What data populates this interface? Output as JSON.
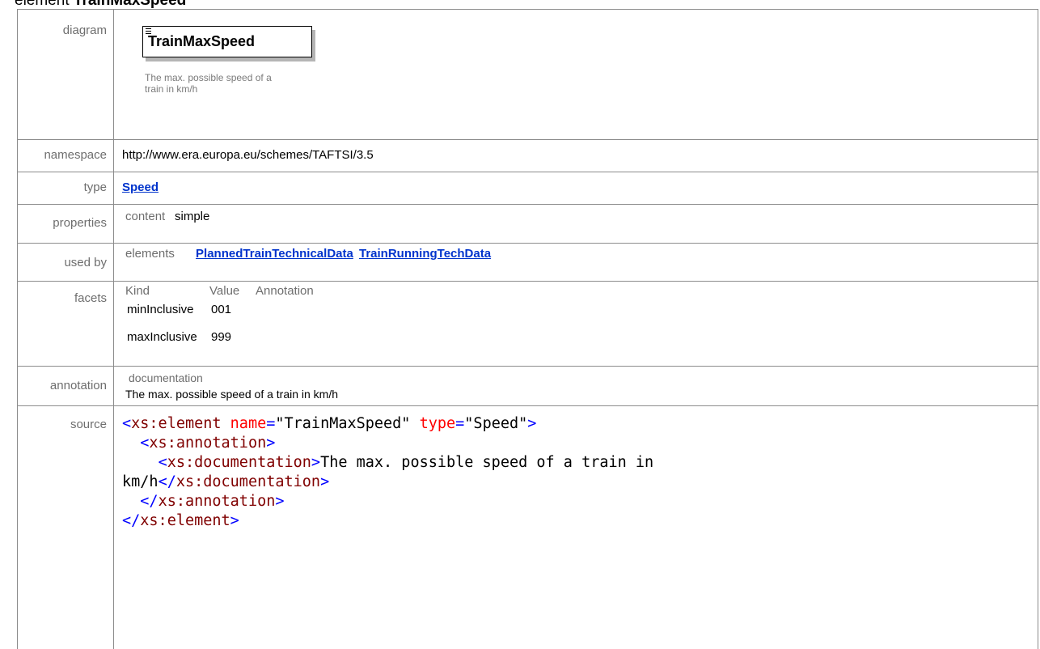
{
  "heading": {
    "prefix": "element",
    "name": "TrainMaxSpeed"
  },
  "rows": {
    "diagram": {
      "label": "diagram",
      "box_name": "TrainMaxSpeed",
      "doc_line1": "The max. possible speed of a",
      "doc_line2": "train in km/h"
    },
    "namespace": {
      "label": "namespace",
      "value": "http://www.era.europa.eu/schemes/TAFTSI/3.5"
    },
    "type": {
      "label": "type",
      "value": "Speed"
    },
    "properties": {
      "label": "properties",
      "key": "content",
      "value": "simple"
    },
    "used_by": {
      "label": "used by",
      "key": "elements",
      "links": [
        "PlannedTrainTechnicalData",
        "TrainRunningTechData"
      ]
    },
    "facets": {
      "label": "facets",
      "headers": [
        "Kind",
        "Value",
        "Annotation"
      ],
      "rows": [
        {
          "kind": "minInclusive",
          "value": "001"
        },
        {
          "kind": "maxInclusive",
          "value": "999"
        }
      ]
    },
    "annotation": {
      "label": "annotation",
      "key": "documentation",
      "value": "The max. possible speed of a train in km/h"
    },
    "source": {
      "label": "source",
      "lt": "<",
      "gt": ">",
      "close_open": "</",
      "el_tag": "xs:element",
      "attr_name": "name",
      "eq": "=",
      "name_val": "\"TrainMaxSpeed\"",
      "attr_type": "type",
      "type_val": "\"Speed\"",
      "ann_tag": "xs:annotation",
      "doc_tag": "xs:documentation",
      "doc_text_1": "The max. possible speed of a train in",
      "doc_text_2": "km/h"
    }
  },
  "colors": {
    "link": "#0033cc",
    "tag": "#0000ff",
    "attr": "#ff0000",
    "tagname": "#800000"
  }
}
